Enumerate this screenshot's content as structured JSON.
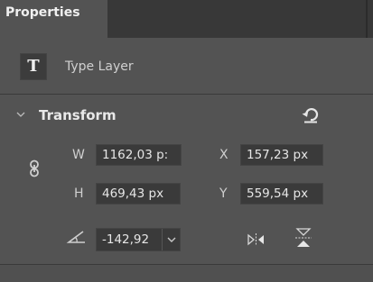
{
  "panel": {
    "tab_label": "Properties"
  },
  "layer": {
    "icon_glyph": "T",
    "label": "Type Layer"
  },
  "transform": {
    "title": "Transform",
    "width_label": "W",
    "width_value": "1162,03 p:",
    "height_label": "H",
    "height_value": "469,43 px",
    "x_label": "X",
    "x_value": "157,23 px",
    "y_label": "Y",
    "y_value": "559,54 px",
    "angle_value": "-142,92"
  },
  "colors": {
    "panel_bg": "#535353",
    "tabbar_bg": "#383838",
    "field_bg": "#3a3a3a",
    "text": "#d6d6d6"
  },
  "icons": {
    "layer": "type-layer-icon",
    "collapse": "chevron-down-icon",
    "reset": "reset-icon",
    "link": "link-proportions-icon",
    "angle": "angle-icon",
    "dropdown": "chevron-down-icon",
    "flip_h": "flip-horizontal-icon",
    "flip_v": "flip-vertical-icon"
  }
}
